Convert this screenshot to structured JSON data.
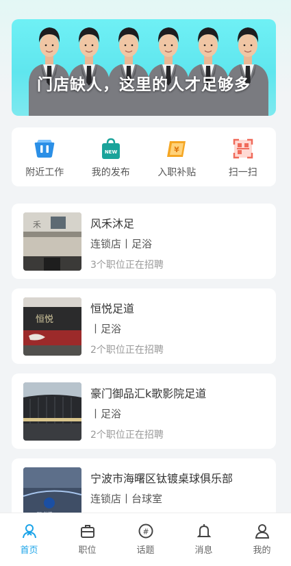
{
  "banner": {
    "text": "门店缺人，这里的人才足够多"
  },
  "quick_actions": [
    {
      "label": "附近工作",
      "icon": "nearby-jobs-icon",
      "color": "#2b8fe6"
    },
    {
      "label": "我的发布",
      "icon": "new-bag-icon",
      "color": "#1aa39a"
    },
    {
      "label": "入职补贴",
      "icon": "subsidy-icon",
      "color": "#f5a623"
    },
    {
      "label": "扫一扫",
      "icon": "scan-icon",
      "color": "#f06a5a"
    }
  ],
  "stores": [
    {
      "name": "风禾沐足",
      "tags": "连锁店丨足浴",
      "positions": "3个职位正在招聘"
    },
    {
      "name": "恒悦足道",
      "tags": "丨足浴",
      "positions": "2个职位正在招聘"
    },
    {
      "name": "豪门御品汇k歌影院足道",
      "tags": "丨足浴",
      "positions": "2个职位正在招聘"
    },
    {
      "name": "宁波市海曙区钛镀桌球俱乐部",
      "tags": "连锁店丨台球室",
      "positions": ""
    }
  ],
  "tabbar": [
    {
      "label": "首页",
      "icon": "home-icon",
      "active": true
    },
    {
      "label": "职位",
      "icon": "briefcase-icon",
      "active": false
    },
    {
      "label": "话题",
      "icon": "topic-icon",
      "active": false
    },
    {
      "label": "消息",
      "icon": "bell-icon",
      "active": false
    },
    {
      "label": "我的",
      "icon": "profile-icon",
      "active": false
    }
  ],
  "colors": {
    "accent": "#1aa3e8",
    "banner_bg": "#6ff0f5",
    "page_bg": "#f2f4f6"
  }
}
